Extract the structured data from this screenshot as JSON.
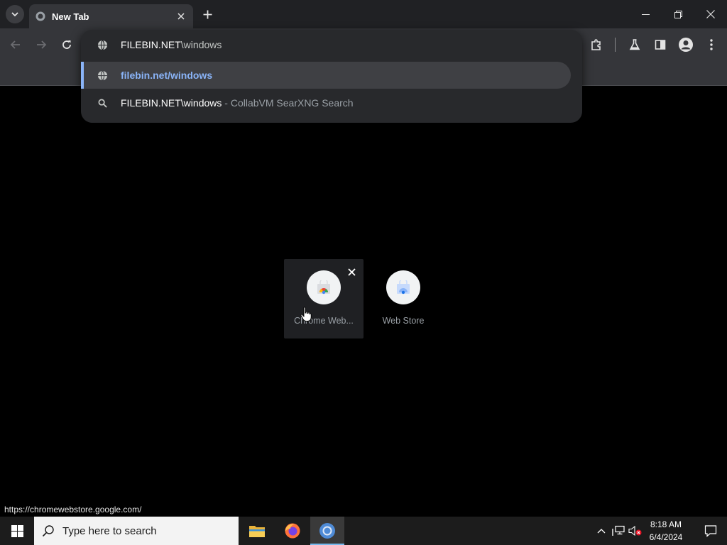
{
  "browser": {
    "tab": {
      "title": "New Tab"
    }
  },
  "omnibox": {
    "typed_strong": "FILEBIN.NET",
    "typed_rest": "\\windows",
    "suggestions": [
      {
        "type": "url",
        "text": "filebin.net/windows"
      },
      {
        "type": "search",
        "query_strong": "FILEBIN.NET",
        "query_rest": "\\windows",
        "description": " - CollabVM SearXNG Search"
      }
    ]
  },
  "shortcuts": [
    {
      "label": "Chrome Web..."
    },
    {
      "label": "Web Store"
    }
  ],
  "status_bar": {
    "url": "https://chromewebstore.google.com/"
  },
  "taskbar": {
    "search_placeholder": "Type here to search",
    "clock": {
      "time": "8:18 AM",
      "date": "6/4/2024"
    }
  },
  "colors": {
    "accent": "#8ab4f8",
    "titlebar": "#202124",
    "toolbar": "#35363a",
    "taskbar": "#1c1c1c"
  }
}
